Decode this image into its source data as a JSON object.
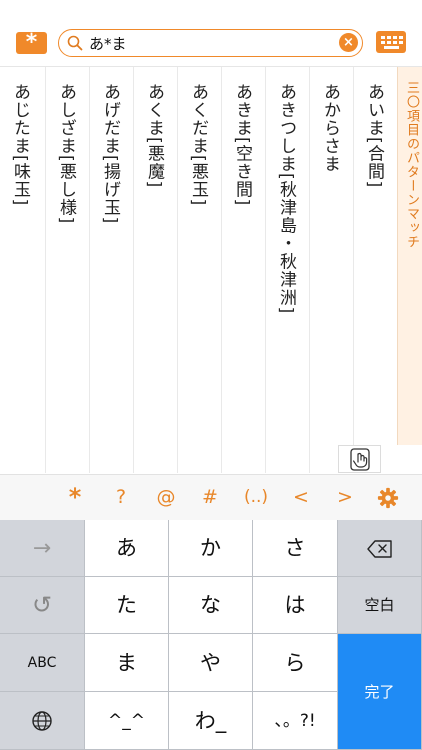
{
  "search": {
    "query": "あ*ま",
    "clear_label": "×"
  },
  "top": {
    "wildcard_symbol": "*"
  },
  "results": {
    "header": "三〇項目のパターンマッチ",
    "items": [
      "あいま[合間]",
      "あからさま",
      "あきつしま[秋津島・秋津洲]",
      "あきま[空き間]",
      "あくだま[悪玉]",
      "あくま[悪魔]",
      "あげだま[揚げ玉]",
      "あしざま[悪し様]",
      "あじたま[味玉]"
    ]
  },
  "toolbar": {
    "wildcard": "*",
    "question": "?",
    "at": "@",
    "hash": "#",
    "paren": "(..)",
    "prev": "<",
    "next": ">"
  },
  "keyboard": {
    "arrow": "→",
    "undo": "↺",
    "abc": "ABC",
    "row1": [
      "あ",
      "か",
      "さ"
    ],
    "row2": [
      "た",
      "な",
      "は"
    ],
    "row3": [
      "ま",
      "や",
      "ら"
    ],
    "row4": [
      "^_^",
      "わ_",
      "、。?!"
    ],
    "space": "空白",
    "done": "完了"
  },
  "colors": {
    "accent": "#F0892A",
    "done_key": "#1F8BF5"
  }
}
